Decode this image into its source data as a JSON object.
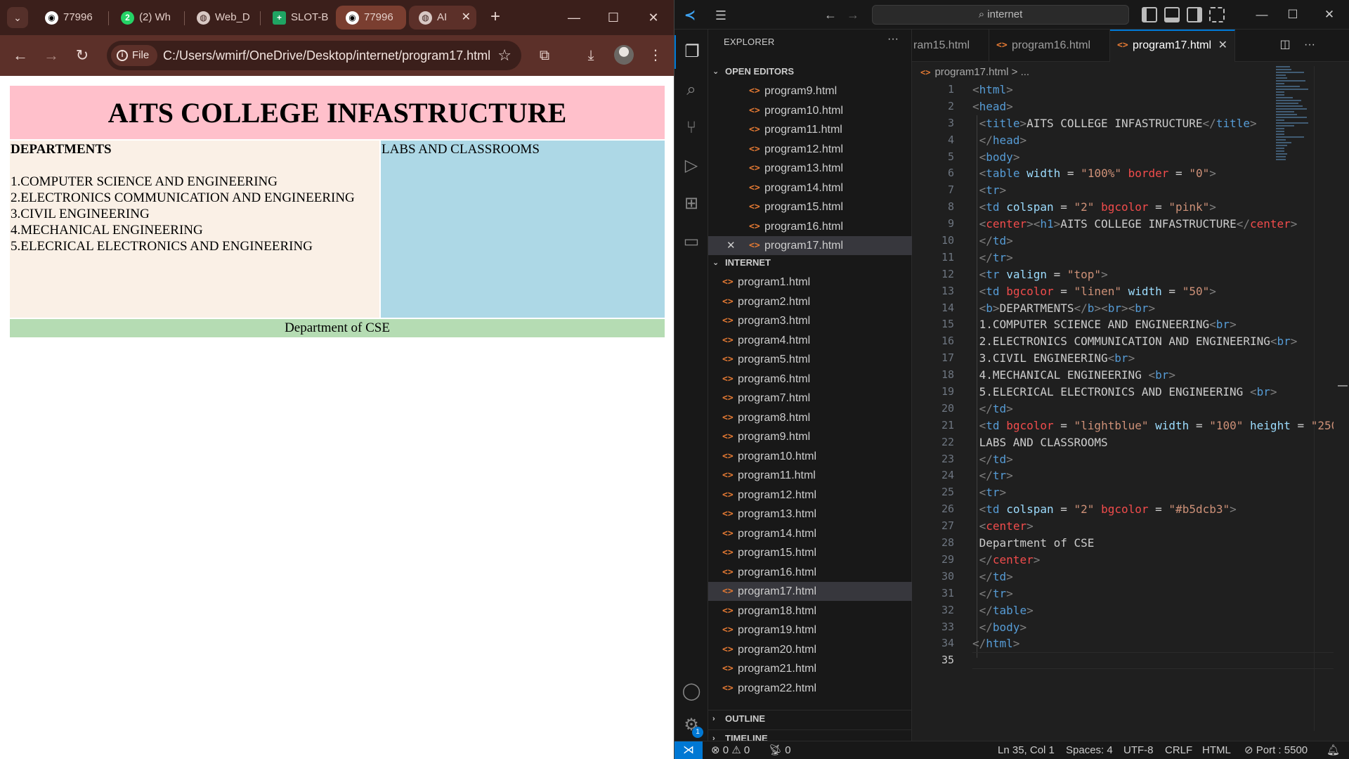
{
  "browser": {
    "tabs": [
      {
        "label": "77996",
        "icon": "github-icon"
      },
      {
        "label": "(2) Wh",
        "icon": "whatsapp-icon",
        "badge": "2"
      },
      {
        "label": "Web_D",
        "icon": "globe-icon"
      },
      {
        "label": "SLOT-B",
        "icon": "sheets-icon"
      },
      {
        "label": "77996",
        "icon": "github-icon"
      },
      {
        "label": "AI",
        "icon": "globe-icon"
      }
    ],
    "address": {
      "chip": "File",
      "url": "C:/Users/wmirf/OneDrive/Desktop/internet/program17.html"
    },
    "page": {
      "title": "AITS COLLEGE INFASTRUCTURE",
      "departments_heading": "DEPARTMENTS",
      "departments": [
        "1.COMPUTER SCIENCE AND ENGINEERING",
        "2.ELECTRONICS COMMUNICATION AND ENGINEERING",
        "3.CIVIL ENGINEERING",
        "4.MECHANICAL ENGINEERING",
        "5.ELECRICAL ELECTRONICS AND ENGINEERING"
      ],
      "labs": "LABS AND CLASSROOMS",
      "footer": "Department of CSE",
      "colors": {
        "title_bg": "#ffc0cb",
        "dept_bg": "#faf0e6",
        "labs_bg": "#add8e6",
        "footer_bg": "#b5dcb3"
      }
    }
  },
  "vscode": {
    "search": "internet",
    "explorer_title": "EXPLORER",
    "open_editors_title": "OPEN EDITORS",
    "open_editors": [
      "program9.html",
      "program10.html",
      "program11.html",
      "program12.html",
      "program13.html",
      "program14.html",
      "program15.html",
      "program16.html",
      "program17.html"
    ],
    "folder_title": "INTERNET",
    "files": [
      "program1.html",
      "program2.html",
      "program3.html",
      "program4.html",
      "program5.html",
      "program6.html",
      "program7.html",
      "program8.html",
      "program9.html",
      "program10.html",
      "program11.html",
      "program12.html",
      "program13.html",
      "program14.html",
      "program15.html",
      "program16.html",
      "program17.html",
      "program18.html",
      "program19.html",
      "program20.html",
      "program21.html",
      "program22.html"
    ],
    "outline": "OUTLINE",
    "timeline": "TIMELINE",
    "editor_tabs": [
      "ram15.html",
      "program16.html",
      "program17.html"
    ],
    "breadcrumb": "program17.html > ...",
    "settings_badge": "1",
    "status": {
      "errors": "0",
      "warnings": "0",
      "ports": "0",
      "position": "Ln 35, Col 1",
      "spaces": "Spaces: 4",
      "encoding": "UTF-8",
      "eol": "CRLF",
      "language": "HTML",
      "port": "Port : 5500"
    }
  }
}
